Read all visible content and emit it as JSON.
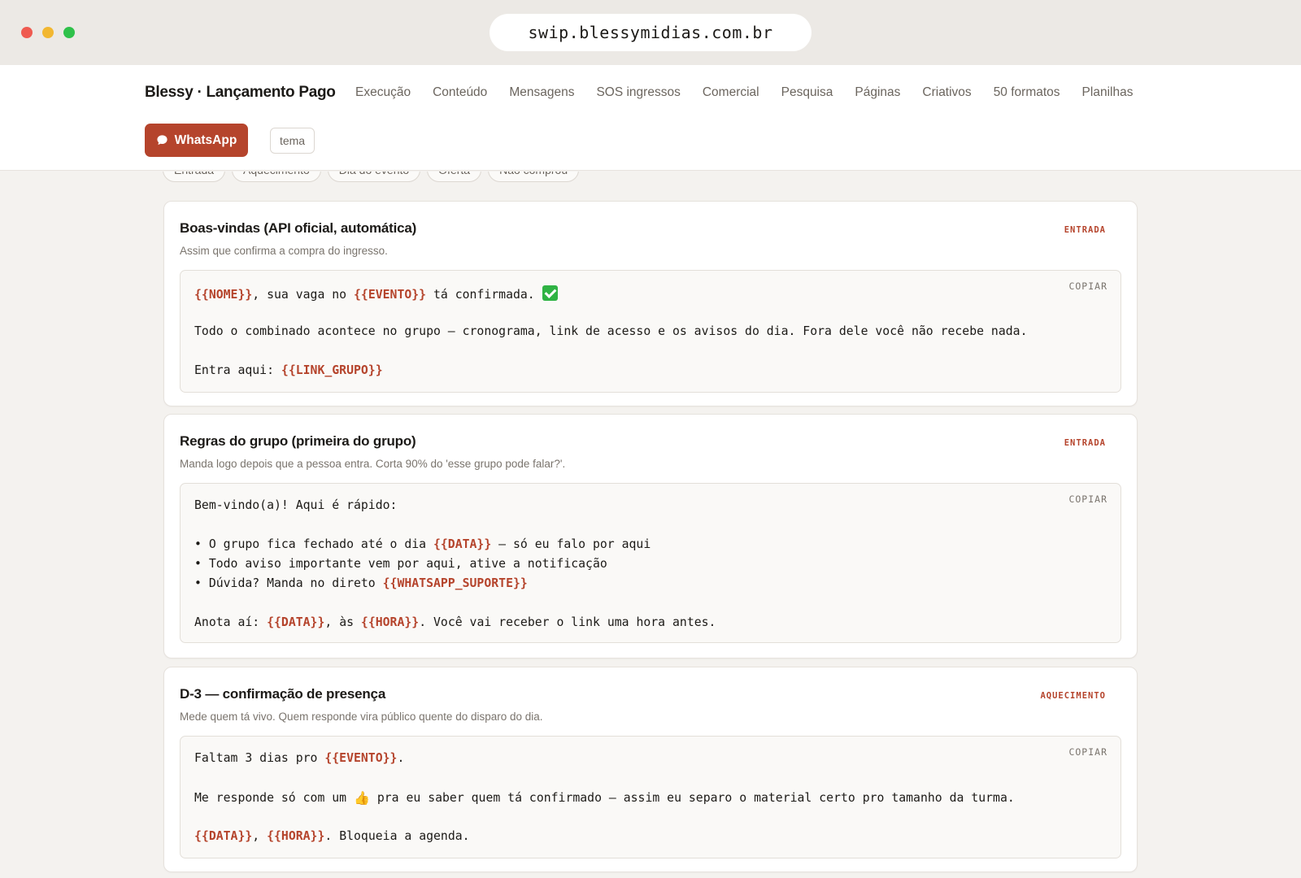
{
  "browser": {
    "url": "swip.blessymidias.com.br"
  },
  "header": {
    "brand": "Blessy · Lançamento Pago",
    "nav": [
      "Execução",
      "Conteúdo",
      "Mensagens",
      "SOS ingressos",
      "Comercial",
      "Pesquisa",
      "Páginas",
      "Criativos",
      "50 formatos",
      "Planilhas"
    ],
    "whatsapp_label": "WhatsApp",
    "theme_label": "tema"
  },
  "filters": [
    "Entrada",
    "Aquecimento",
    "Dia do evento",
    "Oferta",
    "Não comprou"
  ],
  "copy_label": "COPIAR",
  "cards": [
    {
      "title": "Boas-vindas (API oficial, automática)",
      "tag": "ENTRADA",
      "subtitle": "Assim que confirma a compra do ingresso.",
      "lines": {
        "l1_var": "{{NOME}}",
        "l1_mid": ", sua vaga no ",
        "l1_var2": "{{EVENTO}}",
        "l1_end": " tá confirmada. ",
        "l2": "Todo o combinado acontece no grupo — cronograma, link de acesso e os avisos do dia. Fora dele você não recebe nada.",
        "l3_a": "Entra aqui: ",
        "l3_var": "{{LINK_GRUPO}}"
      }
    },
    {
      "title": "Regras do grupo (primeira do grupo)",
      "tag": "ENTRADA",
      "subtitle": "Manda logo depois que a pessoa entra. Corta 90% do 'esse grupo pode falar?'.",
      "lines": {
        "l1": "Bem-vindo(a)! Aqui é rápido:",
        "l2_a": "• O grupo fica fechado até o dia ",
        "l2_var": "{{DATA}}",
        "l2_b": " — só eu falo por aqui",
        "l3": "• Todo aviso importante vem por aqui, ative a notificação",
        "l4_a": "• Dúvida? Manda no direto ",
        "l4_var": "{{WHATSAPP_SUPORTE}}",
        "l5_a": "Anota aí: ",
        "l5_var": "{{DATA}}",
        "l5_b": ", às ",
        "l5_var2": "{{HORA}}",
        "l5_c": ". Você vai receber o link uma hora antes."
      }
    },
    {
      "title": "D-3 — confirmação de presença",
      "tag": "AQUECIMENTO",
      "subtitle": "Mede quem tá vivo. Quem responde vira público quente do disparo do dia.",
      "lines": {
        "l1_a": "Faltam 3 dias pro ",
        "l1_var": "{{EVENTO}}",
        "l1_b": ".",
        "l2_a": "Me responde só com um ",
        "l2_emoji": "👍",
        "l2_b": " pra eu saber quem tá confirmado — assim eu separo o material certo pro tamanho da turma.",
        "l3_var": "{{DATA}}",
        "l3_a": ", ",
        "l3_var2": "{{HORA}}",
        "l3_b": ". Bloqueia a agenda."
      }
    }
  ]
}
